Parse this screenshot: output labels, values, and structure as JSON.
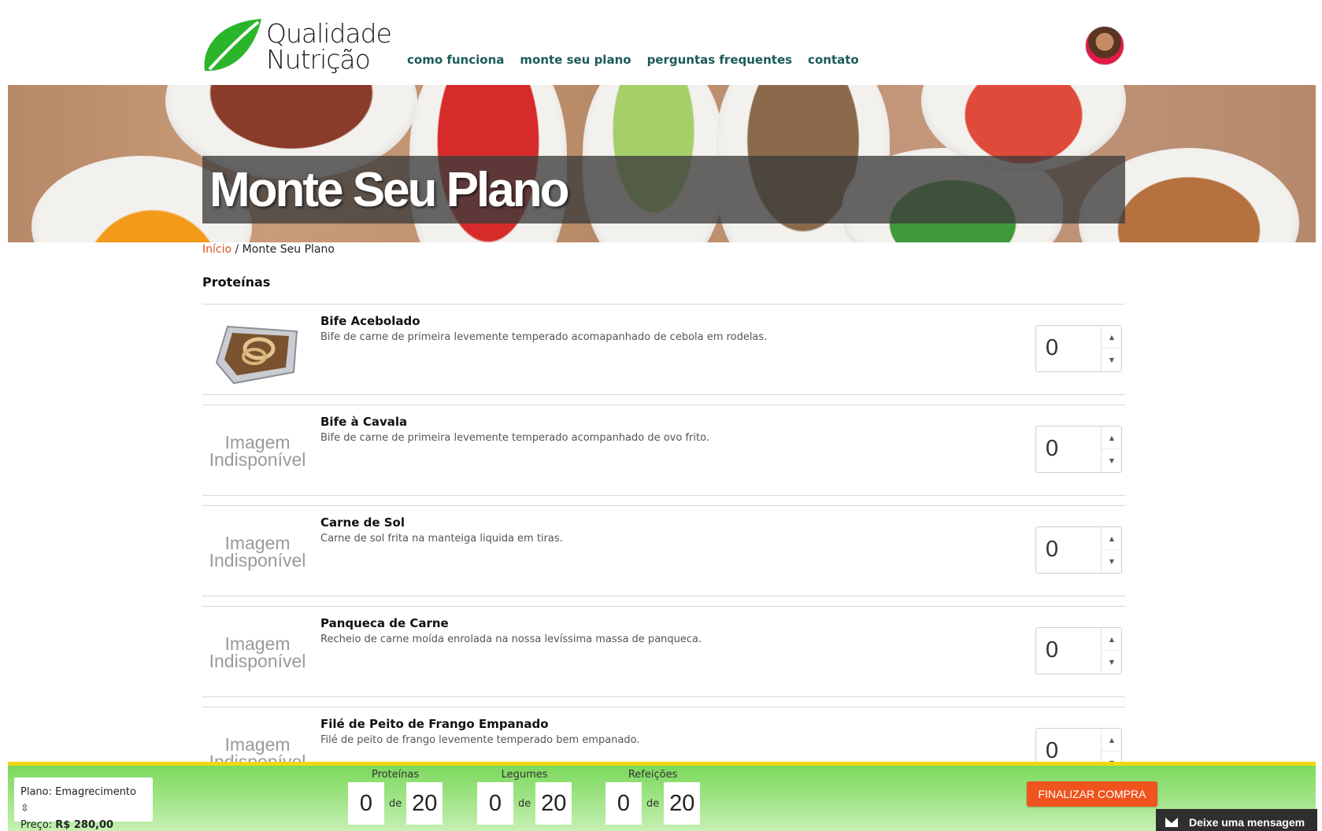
{
  "header": {
    "logo_line1": "Qualidade",
    "logo_line2": "Nutrição",
    "nav": [
      "como funciona",
      "monte seu plano",
      "perguntas frequentes",
      "contato"
    ]
  },
  "banner": {
    "title": "Monte Seu Plano"
  },
  "breadcrumb": {
    "home": "Início",
    "separator": " / ",
    "current": "Monte Seu Plano"
  },
  "section": {
    "title": "Proteínas"
  },
  "products": [
    {
      "name": "Bife Acebolado",
      "description": "Bife de carne de primeira levemente temperado acomapanhado de cebola em rodelas.",
      "quantity": "0",
      "image": "photo"
    },
    {
      "name": "Bife à Cavala",
      "description": "Bife de carne de primeira levemente temperado acompanhado de ovo frito.",
      "quantity": "0",
      "image_text": "Imagem Indisponível"
    },
    {
      "name": "Carne de Sol",
      "description": "Carne de sol frita na manteiga liquida em tiras.",
      "quantity": "0",
      "image_text": "Imagem Indisponível"
    },
    {
      "name": "Panqueca de Carne",
      "description": "Recheio de carne moída enrolada na nossa levíssima massa de panqueca.",
      "quantity": "0",
      "image_text": "Imagem Indisponível"
    },
    {
      "name": "Filé de Peito de Frango Empanado",
      "description": "Filé de peito de frango levemente temperado bem empanado.",
      "quantity": "0",
      "image_text": "Imagem Indisponível"
    }
  ],
  "bottom_bar": {
    "plan_label": "Plano: Emagrecimento ⇳",
    "price_label": "Preço: ",
    "price_value": "R$ 280,00",
    "counters": [
      {
        "label": "Proteínas",
        "current": "0",
        "de": "de",
        "total": "20"
      },
      {
        "label": "Legumes",
        "current": "0",
        "de": "de",
        "total": "20"
      },
      {
        "label": "Refeições",
        "current": "0",
        "de": "de",
        "total": "20"
      }
    ],
    "finish_button": "FINALIZAR COMPRA",
    "message_button": "Deixe uma mensagem"
  },
  "colors": {
    "nav_link": "#1b5a5b",
    "breadcrumb_link": "#e0521e",
    "finish_button": "#f0541e",
    "bar_green": "#7bd95c",
    "bar_top_stripe": "#f0d714"
  },
  "icons": [
    "leaf-logo-icon",
    "avatar",
    "spinner-up-icon",
    "spinner-down-icon",
    "mail-icon"
  ]
}
